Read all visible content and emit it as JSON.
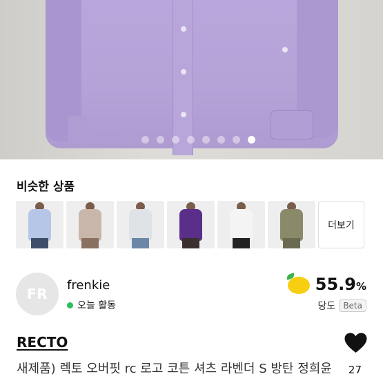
{
  "gallery": {
    "page_count": 8,
    "active_index": 7
  },
  "similar": {
    "title": "비슷한 상품",
    "more_label": "더보기",
    "items": [
      {
        "shirt_color": "#b6c6e6",
        "legs_color": "#3e4e6a"
      },
      {
        "shirt_color": "#c9b6ab",
        "legs_color": "#8a7060"
      },
      {
        "shirt_color": "#dfe2e6",
        "legs_color": "#6c86a8"
      },
      {
        "shirt_color": "#5a2f8a",
        "legs_color": "#3a3030"
      },
      {
        "shirt_color": "#f4f4f4",
        "legs_color": "#222222"
      },
      {
        "shirt_color": "#8a8a6a",
        "legs_color": "#6a6a52"
      }
    ]
  },
  "seller": {
    "initials": "FR",
    "name": "frenkie",
    "status": "오늘 활동",
    "score_value": "55.9",
    "score_unit": "%",
    "score_label": "당도",
    "beta_label": "Beta",
    "status_color": "#2bbf5b",
    "lemon_color": "#f7cf10"
  },
  "product": {
    "brand": "RECTO",
    "title": "새제품) 렉토 오버핏 rc 로고 코튼 셔츠 라벤더 S 방탄 정희윤",
    "like_count": "27"
  }
}
